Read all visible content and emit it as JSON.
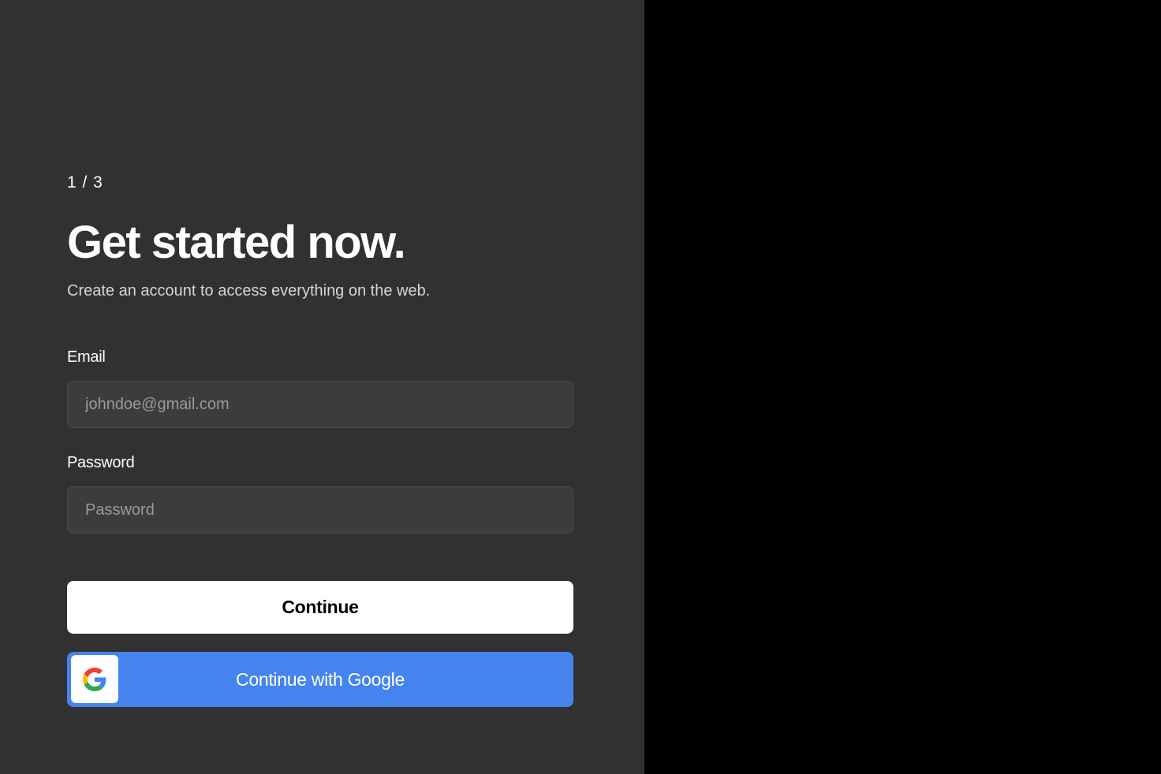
{
  "onboarding": {
    "step_indicator": "1 / 3",
    "title": "Get started now.",
    "subtitle": "Create an account to access everything on the web."
  },
  "form": {
    "email": {
      "label": "Email",
      "placeholder": "johndoe@gmail.com",
      "value": ""
    },
    "password": {
      "label": "Password",
      "placeholder": "Password",
      "value": ""
    },
    "continue_label": "Continue",
    "google_label": "Continue with Google",
    "google_icon": "google-g-icon"
  },
  "colors": {
    "left_panel_bg": "#313132",
    "right_panel_bg": "#000000",
    "input_bg": "#3c3c3d",
    "continue_bg": "#ffffff",
    "google_blue": "#4584ee"
  }
}
